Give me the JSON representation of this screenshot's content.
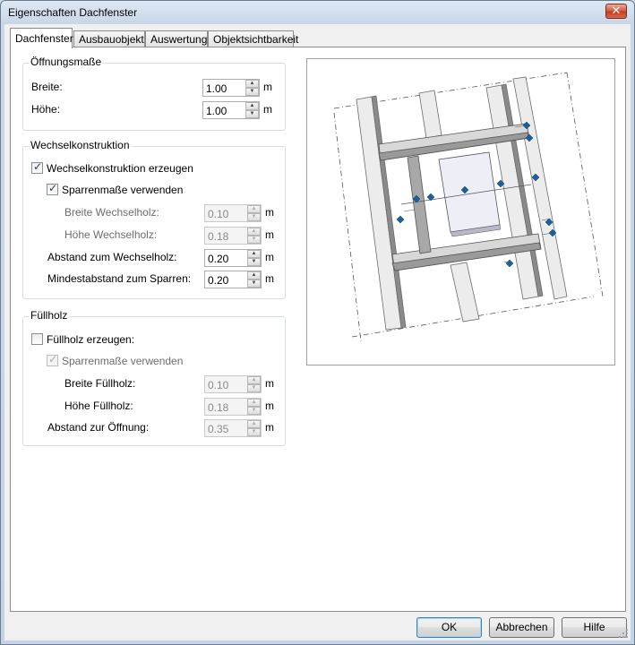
{
  "window": {
    "title": "Eigenschaften Dachfenster",
    "close_glyph": "✕"
  },
  "tabs": [
    {
      "label": "Dachfenster",
      "active": true
    },
    {
      "label": "Ausbauobjekt",
      "active": false
    },
    {
      "label": "Auswertung",
      "active": false
    },
    {
      "label": "Objektsichtbarkeit",
      "active": false
    }
  ],
  "oeffnung": {
    "title": "Öffnungsmaße",
    "breite": {
      "label": "Breite:",
      "value": "1.00",
      "unit": "m"
    },
    "hoehe": {
      "label": "Höhe:",
      "value": "1.00",
      "unit": "m"
    }
  },
  "wechsel": {
    "title": "Wechselkonstruktion",
    "erzeugen": {
      "label": "Wechselkonstruktion erzeugen",
      "checked": true
    },
    "sparren": {
      "label": "Sparrenmaße verwenden",
      "checked": true
    },
    "breite": {
      "label": "Breite Wechselholz:",
      "value": "0.10",
      "unit": "m"
    },
    "hoehe": {
      "label": "Höhe Wechselholz:",
      "value": "0.18",
      "unit": "m"
    },
    "abstand": {
      "label": "Abstand zum Wechselholz:",
      "value": "0.20",
      "unit": "m"
    },
    "mindest": {
      "label": "Mindestabstand zum Sparren:",
      "value": "0.20",
      "unit": "m"
    }
  },
  "fuell": {
    "title": "Füllholz",
    "erzeugen": {
      "label": "Füllholz erzeugen:",
      "checked": false
    },
    "sparren": {
      "label": "Sparrenmaße verwenden",
      "checked": true
    },
    "breite": {
      "label": "Breite Füllholz:",
      "value": "0.10",
      "unit": "m"
    },
    "hoehe": {
      "label": "Höhe Füllholz:",
      "value": "0.18",
      "unit": "m"
    },
    "abstand": {
      "label": "Abstand zur Öffnung:",
      "value": "0.35",
      "unit": "m"
    }
  },
  "buttons": {
    "ok": "OK",
    "cancel": "Abbrechen",
    "help": "Hilfe"
  },
  "colors": {
    "accent": "#3c7fb1",
    "handle": "#1a5fa0",
    "beam": "#a0a0a0"
  }
}
